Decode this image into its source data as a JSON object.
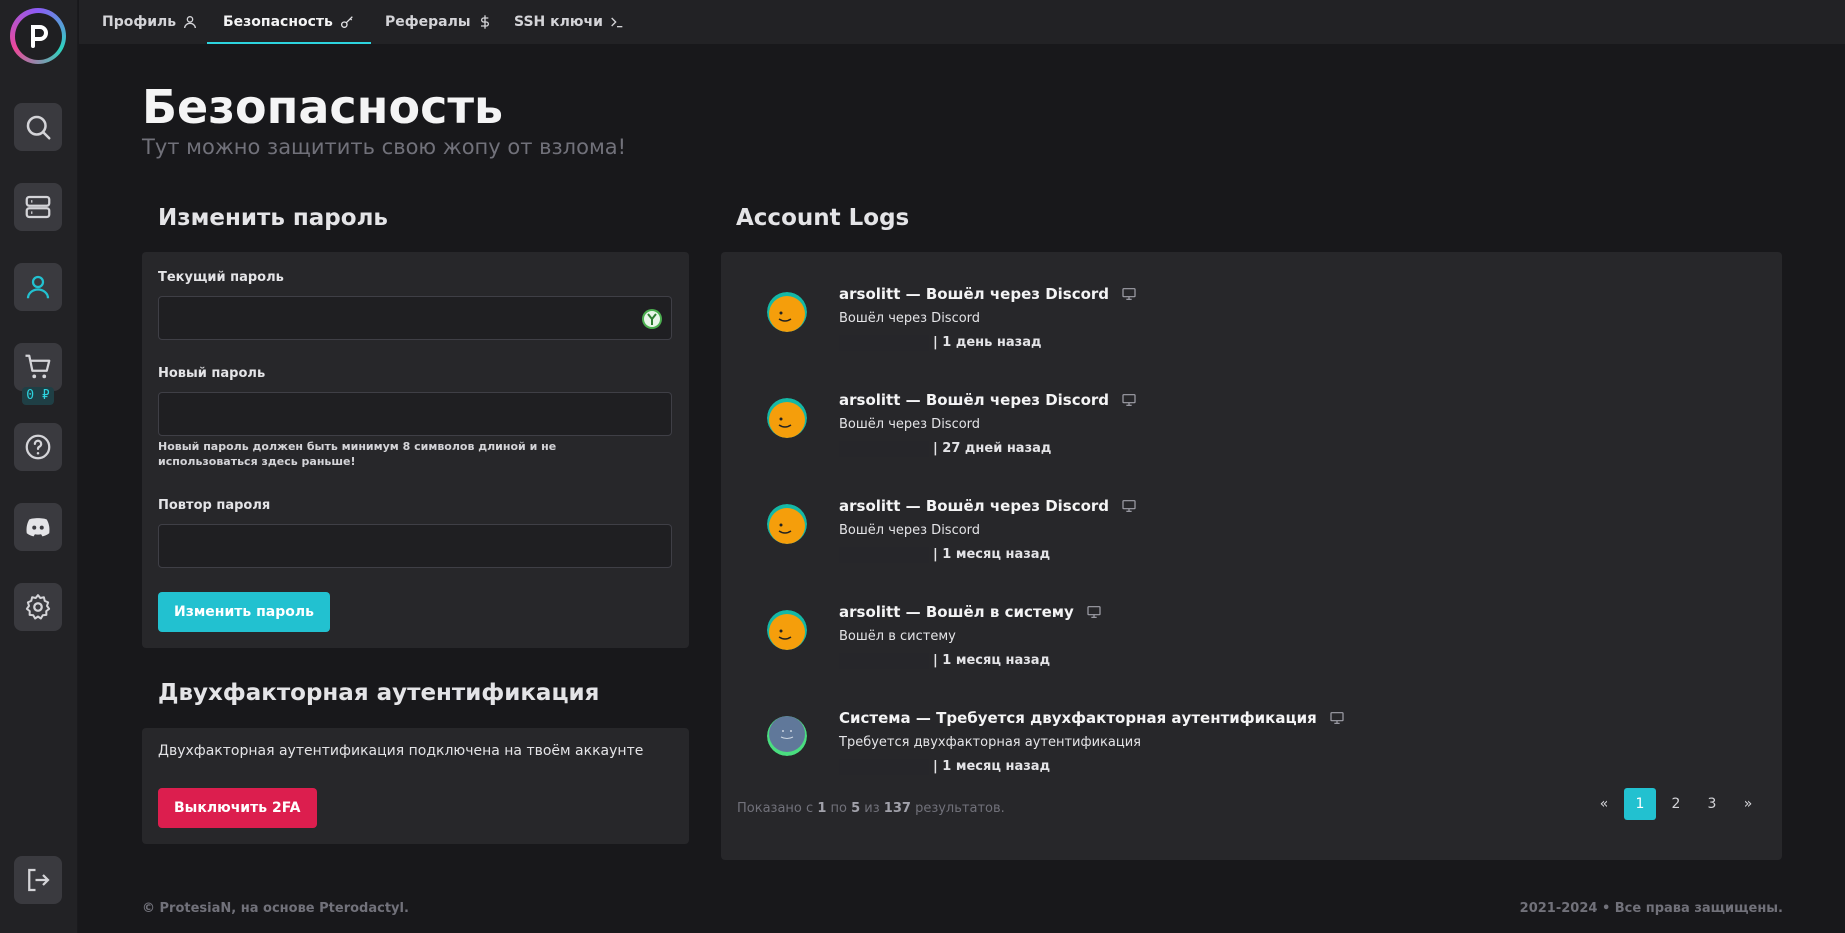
{
  "nav": {
    "tabs": [
      {
        "label": "Профиль",
        "icon": "user-icon"
      },
      {
        "label": "Безопасность",
        "icon": "key-icon"
      },
      {
        "label": "Рефералы",
        "icon": "dollar-icon"
      },
      {
        "label": "SSH ключи",
        "icon": "terminal-icon"
      }
    ]
  },
  "sidebar": {
    "items": [
      {
        "icon": "search-icon"
      },
      {
        "icon": "servers-icon"
      },
      {
        "icon": "user-icon"
      },
      {
        "icon": "cart-icon"
      },
      {
        "icon": "help-icon"
      },
      {
        "icon": "discord-icon"
      },
      {
        "icon": "gear-icon"
      },
      {
        "icon": "logout-icon"
      }
    ],
    "cart_badge": "0 ₽"
  },
  "page": {
    "title": "Безопасность",
    "subtitle": "Тут можно защитить свою жопу от взлома!"
  },
  "password": {
    "section_title": "Изменить пароль",
    "current_label": "Текущий пароль",
    "new_label": "Новый пароль",
    "new_help": "Новый пароль должен быть минимум 8 символов длиной и не использоваться здесь раньше!",
    "repeat_label": "Повтор пароля",
    "submit_label": "Изменить пароль"
  },
  "tfa": {
    "section_title": "Двухфакторная аутентификация",
    "status_text": "Двухфакторная аутентификация подключена на твоём аккаунте",
    "disable_label": "Выключить 2FA"
  },
  "logs": {
    "section_title": "Account Logs",
    "items": [
      {
        "title": "arsolitt — Вошёл через Discord",
        "desc": "Вошёл через Discord",
        "time": "| 1 день назад",
        "avatar": "orange"
      },
      {
        "title": "arsolitt — Вошёл через Discord",
        "desc": "Вошёл через Discord",
        "time": "| 27 дней назад",
        "avatar": "orange"
      },
      {
        "title": "arsolitt — Вошёл через Discord",
        "desc": "Вошёл через Discord",
        "time": "| 1 месяц назад",
        "avatar": "orange"
      },
      {
        "title": "arsolitt — Вошёл в систему",
        "desc": "Вошёл в систему",
        "time": "| 1 месяц назад",
        "avatar": "orange"
      },
      {
        "title": "Система — Требуется двухфакторная аутентификация",
        "desc": "Требуется двухфакторная аутентификация",
        "time": "| 1 месяц назад",
        "avatar": "blue"
      }
    ],
    "pager_prefix": "Показано с",
    "pager_from": "1",
    "pager_mid1": "по",
    "pager_to": "5",
    "pager_mid2": "из",
    "pager_total": "137",
    "pager_suffix": "результатов.",
    "pages": [
      "«",
      "1",
      "2",
      "3",
      "»"
    ],
    "active_page": "1"
  },
  "footer": {
    "left": "© ProtesiaN, на основе Pterodactyl.",
    "right": "2021-2024 • Все права защищены."
  },
  "colors": {
    "accent": "#22c1d0",
    "danger": "#dc1e4e",
    "background": "#18181b",
    "card": "#27272a"
  }
}
